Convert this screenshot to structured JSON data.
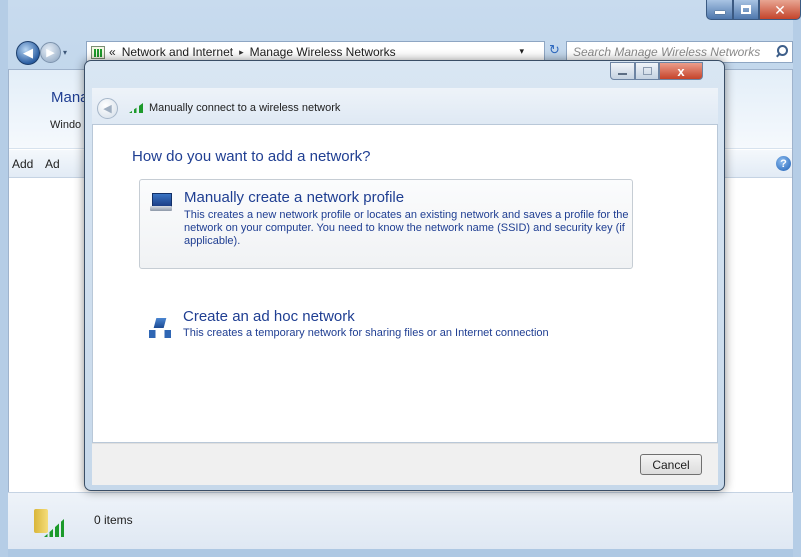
{
  "window": {
    "buttons": {
      "minimize_icon": "minimize-icon",
      "maximize_icon": "maximize-icon",
      "close_icon": "close-icon"
    }
  },
  "nav": {
    "address_chevron": "«",
    "breadcrumbs": [
      "Network and Internet",
      "Manage Wireless Networks"
    ],
    "separator": "▸",
    "dropdown_arrow": "▾",
    "refresh": "↻",
    "search_placeholder": "Search Manage Wireless Networks"
  },
  "pane": {
    "title": "Mana",
    "subtitle": "Windo",
    "toolbar": {
      "add": "Add",
      "second": "Ad",
      "help": "?"
    },
    "status": "0 items"
  },
  "dialog": {
    "title": "Manually connect to a wireless network",
    "question": "How do you want to add a network?",
    "options": [
      {
        "title": "Manually create a network profile",
        "description": "This creates a new network profile or locates an existing network and saves a profile for the network on your computer. You need to know the network name (SSID) and security key (if applicable).",
        "icon": "network-profile-icon"
      },
      {
        "title": "Create an ad hoc network",
        "description": "This creates a temporary network for sharing files or an Internet connection",
        "icon": "adhoc-network-icon"
      }
    ],
    "cancel": "Cancel",
    "close_glyph": "x"
  },
  "colors": {
    "link_blue": "#1f3e92",
    "frame": "#b7cfe8",
    "close_red": "#c5432a"
  }
}
